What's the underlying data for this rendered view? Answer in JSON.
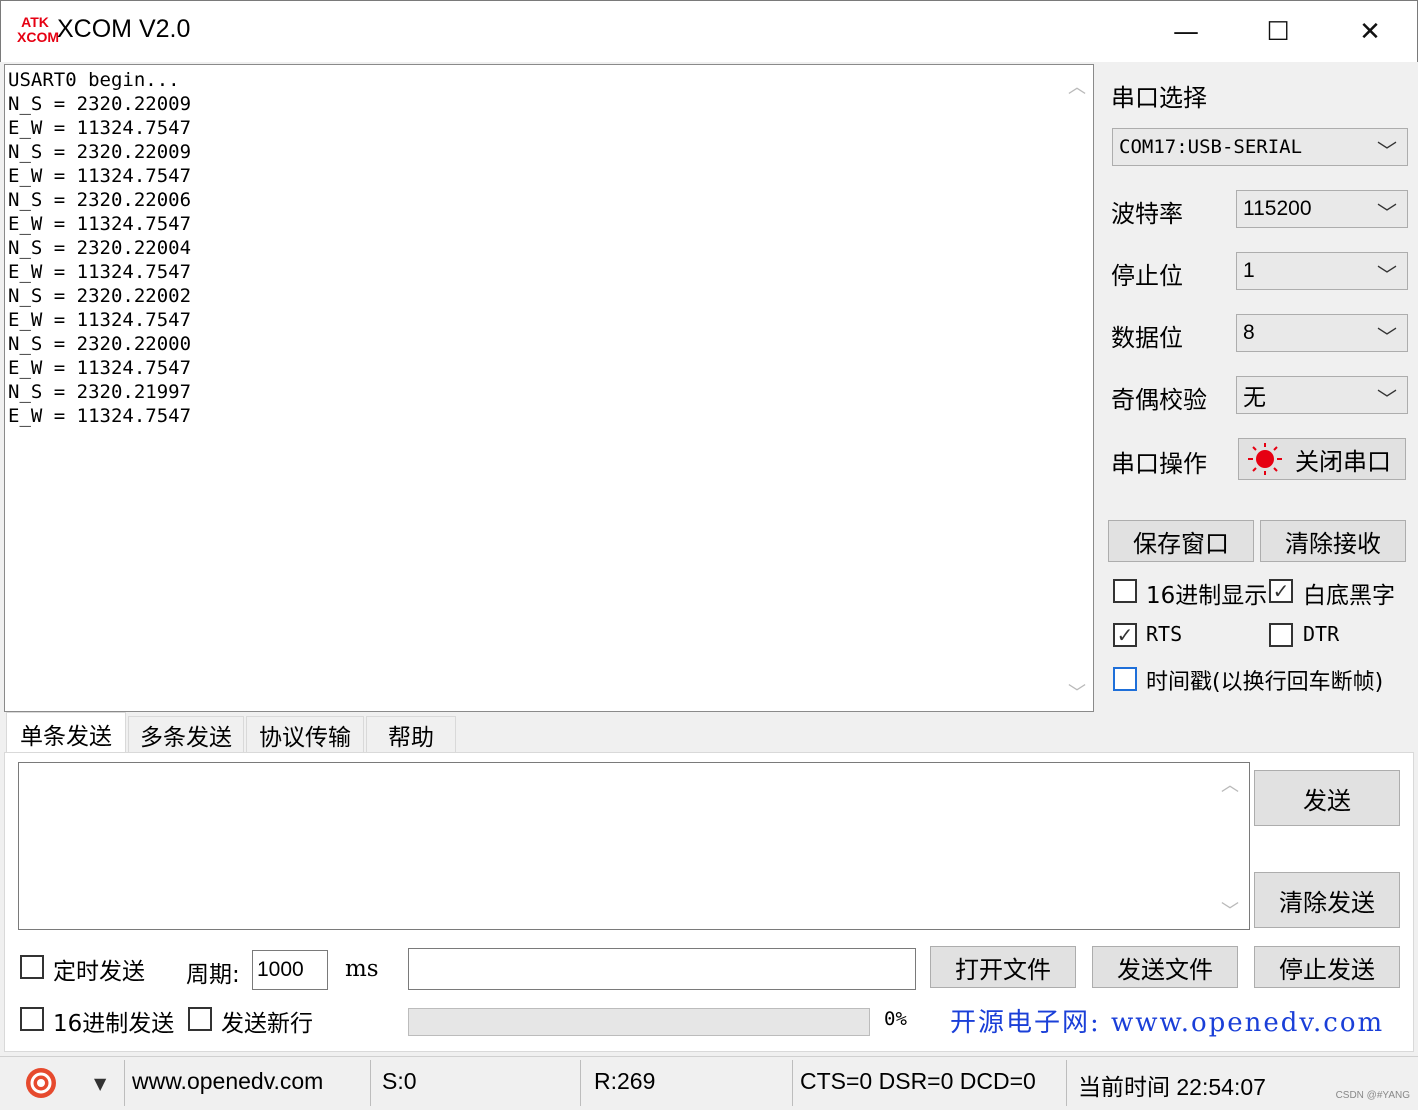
{
  "window": {
    "logo_top": "ATK",
    "logo_bottom": "XCOM",
    "title": "XCOM V2.0",
    "minimize": "—",
    "maximize": "☐",
    "close": "✕"
  },
  "receive": {
    "lines": [
      "USART0 begin...",
      "N_S = 2320.22009",
      "E_W = 11324.7547",
      "N_S = 2320.22009",
      "E_W = 11324.7547",
      "N_S = 2320.22006",
      "E_W = 11324.7547",
      "N_S = 2320.22004",
      "E_W = 11324.7547",
      "N_S = 2320.22002",
      "E_W = 11324.7547",
      "N_S = 2320.22000",
      "E_W = 11324.7547",
      "N_S = 2320.21997",
      "E_W = 11324.7547"
    ]
  },
  "settings": {
    "port_label": "串口选择",
    "port_value": "COM17:USB-SERIAL",
    "baud_label": "波特率",
    "baud_value": "115200",
    "stop_label": "停止位",
    "stop_value": "1",
    "data_label": "数据位",
    "data_value": "8",
    "parity_label": "奇偶校验",
    "parity_value": "无",
    "op_label": "串口操作",
    "op_button": "关闭串口",
    "save_window": "保存窗口",
    "clear_recv": "清除接收",
    "hex_display": "16进制显示",
    "hex_display_checked": false,
    "white_bg": "白底黑字",
    "white_bg_checked": true,
    "rts": "RTS",
    "rts_checked": true,
    "dtr": "DTR",
    "dtr_checked": false,
    "timestamp": "时间戳(以换行回车断帧)",
    "timestamp_checked": false
  },
  "tabs": [
    "单条发送",
    "多条发送",
    "协议传输",
    "帮助"
  ],
  "send": {
    "text": "",
    "send_button": "发送",
    "clear_send": "清除发送",
    "timed_send": "定时发送",
    "timed_send_checked": false,
    "period_label": "周期:",
    "period_value": "1000",
    "ms": "ms",
    "file_path": "",
    "open_file": "打开文件",
    "send_file": "发送文件",
    "stop_send": "停止发送",
    "hex_send": "16进制发送",
    "hex_send_checked": false,
    "newline": "发送新行",
    "newline_checked": false,
    "progress_pct": "0%",
    "ad_text": "开源电子网: www.openedv.com"
  },
  "status": {
    "url": "www.openedv.com",
    "sent": "S:0",
    "received": "R:269",
    "lines": "CTS=0 DSR=0 DCD=0",
    "time": "当前时间 22:54:07",
    "watermark": "CSDN @#YANG"
  },
  "colors": {
    "accent_red": "#e60012",
    "link_blue": "#1a3fd8",
    "checkbox_blue": "#1e6fd9"
  }
}
